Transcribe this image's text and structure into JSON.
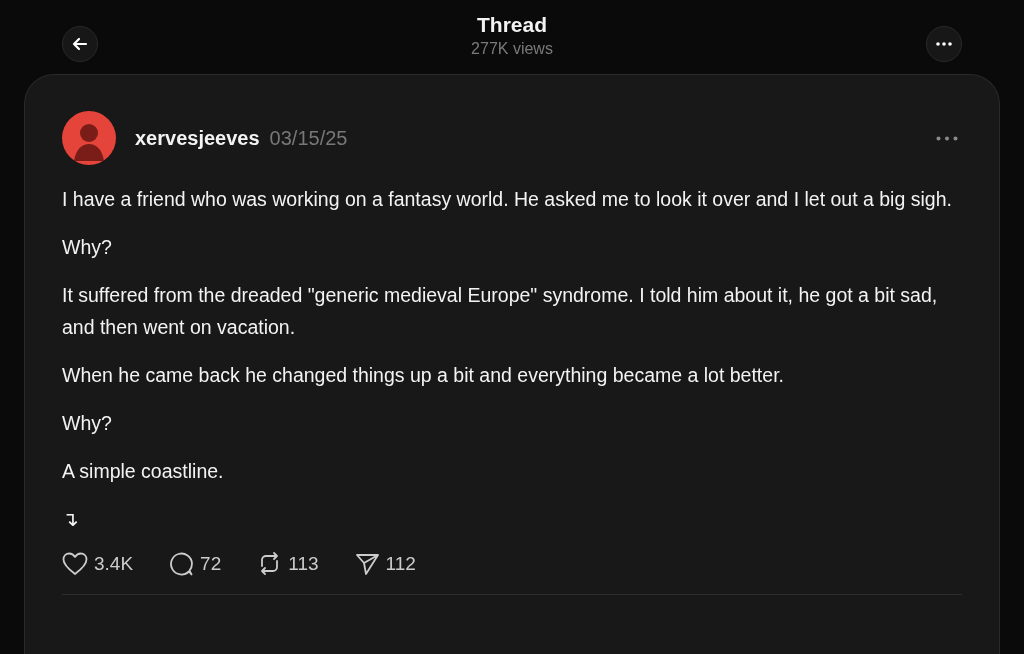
{
  "header": {
    "title": "Thread",
    "views": "277K views"
  },
  "post": {
    "username": "xervesjeeves",
    "date": "03/15/25",
    "paragraphs": [
      "I have a friend who was working on a fantasy world. He asked me to look it over and I let out a big sigh.",
      "Why?",
      "It suffered from the dreaded \"generic medieval Europe\" syndrome. I told him about it, he got a bit sad, and then went on vacation.",
      "When he came back he changed things up a bit and everything became a lot better.",
      "Why?",
      "A simple coastline.",
      "↴"
    ],
    "actions": [
      {
        "kind": "like",
        "count": "3.4K"
      },
      {
        "kind": "reply",
        "count": "72"
      },
      {
        "kind": "repost",
        "count": "113"
      },
      {
        "kind": "share",
        "count": "112"
      }
    ]
  }
}
